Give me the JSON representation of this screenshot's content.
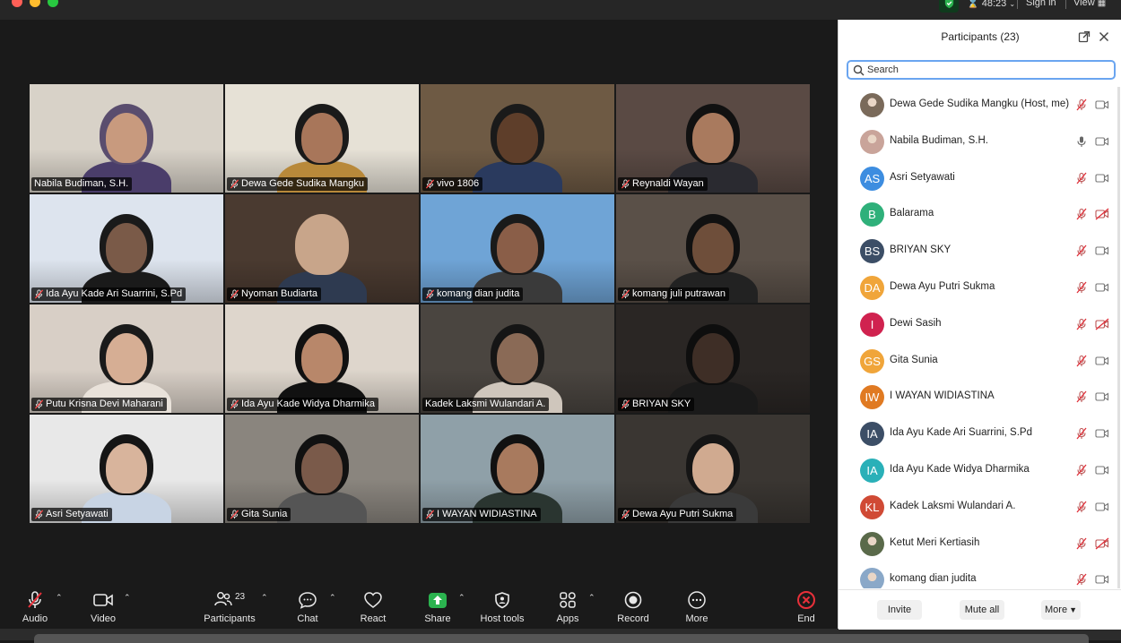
{
  "topbar": {
    "timer": "48:23",
    "sign_in": "Sign in",
    "view": "View",
    "colors": {
      "close": "#ff5f57",
      "minimize": "#febc2e",
      "zoom": "#28c840",
      "security": "#2bb34f"
    }
  },
  "tiles": [
    {
      "name": "Nabila Budiman, S.H.",
      "muted": false,
      "active": true,
      "bg": "#d8d2c8",
      "skin": "#c89a7e",
      "shirt": "#4a3d6a",
      "hair": "#5a4d6e"
    },
    {
      "name": "Dewa Gede Sudika Mangku",
      "muted": true,
      "active": false,
      "bg": "#e6e1d6",
      "skin": "#a8765a",
      "shirt": "#b8893a",
      "hair": "#1a1a1a"
    },
    {
      "name": "vivo 1806",
      "muted": true,
      "active": false,
      "bg": "#6e5a44",
      "skin": "#5e3e2a",
      "shirt": "#2a3a5e",
      "hair": "#1a1a1a"
    },
    {
      "name": "Reynaldi Wayan",
      "muted": true,
      "active": false,
      "bg": "#5a4a44",
      "skin": "#a97a5e",
      "shirt": "#2a2a30",
      "hair": "#111"
    },
    {
      "name": "Ida Ayu Kade Ari Suarrini, S.Pd",
      "muted": true,
      "active": false,
      "bg": "#dde4ee",
      "skin": "#7a5a48",
      "shirt": "#1a1a1a",
      "hair": "#1a1a1a"
    },
    {
      "name": "Nyoman Budiarta",
      "muted": true,
      "active": false,
      "bg": "#4a3a30",
      "skin": "#c8a58a",
      "shirt": "#2e3a50",
      "hair": "#c8a58a"
    },
    {
      "name": "komang dian judita",
      "muted": true,
      "active": false,
      "bg": "#6fa4d6",
      "skin": "#8a5e48",
      "shirt": "#3a3a3a",
      "hair": "#1a1a1a"
    },
    {
      "name": "komang juli putrawan",
      "muted": true,
      "active": false,
      "bg": "#5a5048",
      "skin": "#6e4e3a",
      "shirt": "#222",
      "hair": "#111"
    },
    {
      "name": "Putu Krisna Devi Maharani",
      "muted": true,
      "active": false,
      "bg": "#d8cfc6",
      "skin": "#d6ae94",
      "shirt": "#e9e2da",
      "hair": "#1a1a1a"
    },
    {
      "name": "Ida Ayu Kade Widya Dharmika",
      "muted": true,
      "active": false,
      "bg": "#ded6cc",
      "skin": "#b8876a",
      "shirt": "#111",
      "hair": "#111"
    },
    {
      "name": "Kadek Laksmi Wulandari A.",
      "muted": false,
      "active": false,
      "bg": "#4a4540",
      "skin": "#8a6a56",
      "shirt": "#cfc6bc",
      "hair": "#151515"
    },
    {
      "name": "BRIYAN SKY",
      "muted": true,
      "active": false,
      "bg": "#2a2624",
      "skin": "#3e2e26",
      "shirt": "#1a1a1a",
      "hair": "#0e0e0e"
    },
    {
      "name": "Asri Setyawati",
      "muted": true,
      "active": false,
      "bg": "#e8e8e8",
      "skin": "#d8b49c",
      "shirt": "#c8d4e4",
      "hair": "#151515"
    },
    {
      "name": "Gita Sunia",
      "muted": true,
      "active": false,
      "bg": "#8a857e",
      "skin": "#7a5a4a",
      "shirt": "#555",
      "hair": "#111"
    },
    {
      "name": "I WAYAN WIDIASTINA",
      "muted": true,
      "active": false,
      "bg": "#8fa0a8",
      "skin": "#a87a5e",
      "shirt": "#2a3530",
      "hair": "#111"
    },
    {
      "name": "Dewa Ayu Putri Sukma",
      "muted": true,
      "active": false,
      "bg": "#3a3632",
      "skin": "#d0aa90",
      "shirt": "#3a3a3a",
      "hair": "#151515"
    }
  ],
  "toolbar": {
    "audio": "Audio",
    "video": "Video",
    "participants": "Participants",
    "participants_count": "23",
    "chat": "Chat",
    "react": "React",
    "share": "Share",
    "host_tools": "Host tools",
    "apps": "Apps",
    "record": "Record",
    "more": "More",
    "end": "End",
    "share_color": "#2bb34f",
    "end_color": "#e8303a"
  },
  "panel": {
    "title": "Participants (23)",
    "search_placeholder": "Search",
    "invite": "Invite",
    "mute_all": "Mute all",
    "more": "More",
    "participants": [
      {
        "initials": "",
        "name": "Dewa Gede Sudika Mangku (Host, me)",
        "avatar_color": "#7a6a5a",
        "photo": true,
        "mic_muted": true,
        "cam_off": false
      },
      {
        "initials": "",
        "name": "Nabila Budiman, S.H.",
        "avatar_color": "#c9a49a",
        "photo": true,
        "mic_muted": false,
        "cam_off": false
      },
      {
        "initials": "AS",
        "name": "Asri Setyawati",
        "avatar_color": "#3d8de0",
        "photo": false,
        "mic_muted": true,
        "cam_off": false
      },
      {
        "initials": "B",
        "name": "Balarama",
        "avatar_color": "#2fb07a",
        "photo": false,
        "mic_muted": true,
        "cam_off": true
      },
      {
        "initials": "BS",
        "name": "BRIYAN SKY",
        "avatar_color": "#3c4e66",
        "photo": false,
        "mic_muted": true,
        "cam_off": false
      },
      {
        "initials": "DA",
        "name": "Dewa Ayu Putri Sukma",
        "avatar_color": "#f0a53a",
        "photo": false,
        "mic_muted": true,
        "cam_off": false
      },
      {
        "initials": "I",
        "name": "Dewi Sasih",
        "avatar_color": "#d0224f",
        "photo": false,
        "mic_muted": true,
        "cam_off": true
      },
      {
        "initials": "GS",
        "name": "Gita Sunia",
        "avatar_color": "#f0a53a",
        "photo": false,
        "mic_muted": true,
        "cam_off": false
      },
      {
        "initials": "IW",
        "name": "I WAYAN WIDIASTINA",
        "avatar_color": "#e07a22",
        "photo": false,
        "mic_muted": true,
        "cam_off": false
      },
      {
        "initials": "IA",
        "name": "Ida Ayu Kade Ari Suarrini, S.Pd",
        "avatar_color": "#3c4e66",
        "photo": false,
        "mic_muted": true,
        "cam_off": false
      },
      {
        "initials": "IA",
        "name": "Ida Ayu Kade Widya Dharmika",
        "avatar_color": "#2ab0b8",
        "photo": false,
        "mic_muted": true,
        "cam_off": false
      },
      {
        "initials": "KL",
        "name": "Kadek Laksmi Wulandari A.",
        "avatar_color": "#d04a35",
        "photo": false,
        "mic_muted": true,
        "cam_off": false
      },
      {
        "initials": "",
        "name": "Ketut Meri Kertiasih",
        "avatar_color": "#5a6a4a",
        "photo": true,
        "mic_muted": true,
        "cam_off": true
      },
      {
        "initials": "",
        "name": "komang dian judita",
        "avatar_color": "#8aa8c8",
        "photo": true,
        "mic_muted": true,
        "cam_off": false
      }
    ]
  }
}
